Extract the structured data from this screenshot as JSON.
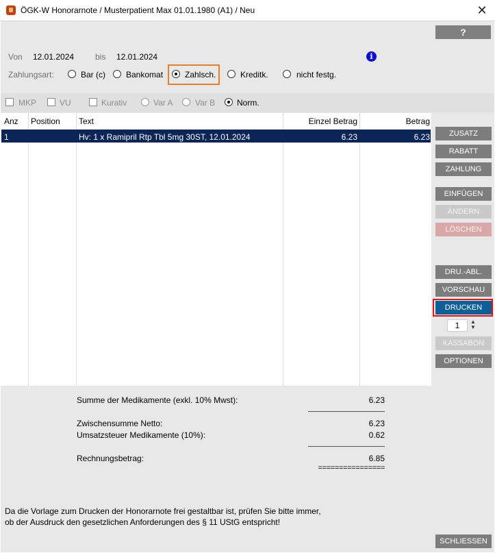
{
  "window": {
    "title": "ÖGK-W Honorarnote / Musterpatient Max 01.01.1980 (A1) / Neu",
    "close_symbol": "✕"
  },
  "help_button": "?",
  "dates": {
    "from_label": "Von",
    "from_value": "12.01.2024",
    "to_label": "bis",
    "to_value": "12.01.2024"
  },
  "payment": {
    "label": "Zahlungsart:",
    "options": [
      {
        "label": "Bar (c)",
        "selected": false
      },
      {
        "label": "Bankomat",
        "selected": false
      },
      {
        "label": "Zahlsch.",
        "selected": true
      },
      {
        "label": "Kreditk.",
        "selected": false
      },
      {
        "label": "nicht festg.",
        "selected": false
      }
    ]
  },
  "flags": {
    "mkp": "MKP",
    "vu": "VU",
    "kurativ": "Kurativ",
    "var_a": "Var A",
    "var_b": "Var B",
    "norm": "Norm.",
    "selected": "Norm."
  },
  "table": {
    "headers": {
      "anz": "Anz",
      "position": "Position",
      "text": "Text",
      "einzel": "Einzel Betrag",
      "betrag": "Betrag"
    },
    "rows": [
      {
        "anz": "1",
        "position": "",
        "text": "Hv: 1 x Ramipril Rtp Tbl  5mg 30ST, 12.01.2024",
        "einzel": "6.23",
        "betrag": "6.23"
      }
    ]
  },
  "side_buttons": {
    "zusatz": "ZUSATZ",
    "rabatt": "RABATT",
    "zahlung": "ZAHLUNG",
    "einfuegen": "EINFÜGEN",
    "aendern": "ÄNDERN",
    "loeschen": "LÖSCHEN",
    "dru_abl": "DRU.-ABL.",
    "vorschau": "VORSCHAU",
    "drucken": "DRUCKEN",
    "copies": "1",
    "kassabon": "KASSABON",
    "optionen": "OPTIONEN"
  },
  "summary": {
    "medikamente_label": "Summe der Medikamente (exkl. 10% Mwst):",
    "medikamente_value": "6.23",
    "netto_label": "Zwischensumme Netto:",
    "netto_value": "6.23",
    "ust_label": "Umsatzsteuer Medikamente (10%):",
    "ust_value": "0.62",
    "total_label": "Rechnungsbetrag:",
    "total_value": "6.85",
    "double_rule": "================"
  },
  "footer": {
    "note_line1": "Da die Vorlage zum Drucken der Honorarnote frei gestaltbar ist, prüfen Sie bitte immer,",
    "note_line2": "ob der Ausdruck den gesetzlichen Anforderungen des § 11 UStG entspricht!",
    "close_button": "SCHLIESSEN"
  },
  "colors": {
    "selection": "#0b2559",
    "primary_button": "#0d5f95",
    "button": "#7d7d7d",
    "highlight_orange": "#e87e28",
    "highlight_red": "#e01414",
    "info_blue": "#1010d0"
  },
  "icons": {
    "app": "app-icon",
    "close": "close-icon",
    "info": "info-icon",
    "spinner": "spinner-arrows-icon"
  }
}
